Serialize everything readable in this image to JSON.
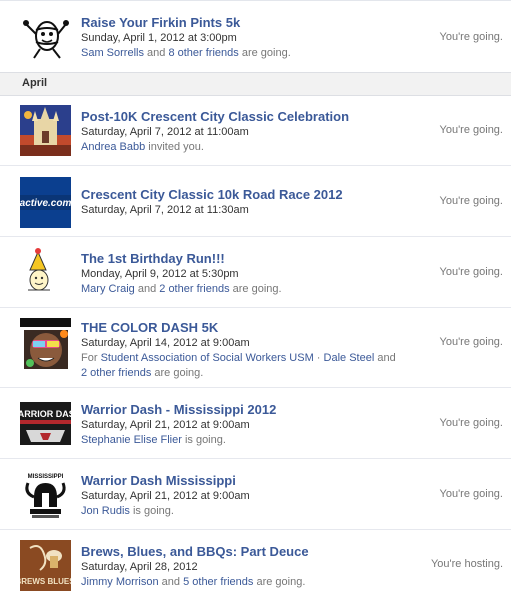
{
  "month_header": "April",
  "events": [
    {
      "title": "Raise Your Firkin Pints 5k",
      "date": "Sunday, April 1, 2012",
      "at": "at",
      "time": "3:00pm",
      "social": [
        {
          "t": "Sam Sorrells",
          "link": true
        },
        {
          "t": " and ",
          "link": false
        },
        {
          "t": "8 other friends",
          "link": true
        },
        {
          "t": " are going.",
          "link": false
        }
      ],
      "status": "You're going.",
      "icon": "keg-mascot-icon"
    },
    {
      "title": "Post-10K Crescent City Classic Celebration",
      "date": "Saturday, April 7, 2012",
      "at": "at",
      "time": "11:00am",
      "social": [
        {
          "t": "Andrea Babb",
          "link": true
        },
        {
          "t": " invited you.",
          "link": false
        }
      ],
      "status": "You're going.",
      "icon": "cathedral-painting-icon"
    },
    {
      "title": "Crescent City Classic 10k Road Race 2012",
      "date": "Saturday, April 7, 2012",
      "at": "at",
      "time": "11:30am",
      "social": [],
      "status": "You're going.",
      "icon": "active-com-logo-icon",
      "logo_text": "active.com"
    },
    {
      "title": "The 1st Birthday Run!!!",
      "date": "Monday, April 9, 2012",
      "at": "at",
      "time": "5:30pm",
      "social": [
        {
          "t": "Mary Craig",
          "link": true
        },
        {
          "t": " and ",
          "link": false
        },
        {
          "t": "2 other friends",
          "link": true
        },
        {
          "t": " are going.",
          "link": false
        }
      ],
      "status": "You're going.",
      "icon": "party-hat-icon"
    },
    {
      "title": "THE COLOR DASH 5K",
      "date": "Saturday, April 14, 2012",
      "at": "at",
      "time": "9:00am",
      "social": [
        {
          "t": "For ",
          "link": false
        },
        {
          "t": "Student Association of Social Workers USM",
          "link": true
        },
        {
          "t": " · ",
          "link": false
        },
        {
          "t": "Dale Steel",
          "link": true
        },
        {
          "t": " and",
          "link": false
        }
      ],
      "social2": [
        {
          "t": "2 other friends",
          "link": true
        },
        {
          "t": " are going.",
          "link": false
        }
      ],
      "status": "You're going.",
      "icon": "color-dash-runner-icon"
    },
    {
      "title": "Warrior Dash - Mississippi 2012",
      "date": "Saturday, April 21, 2012",
      "at": "at",
      "time": "9:00am",
      "social": [
        {
          "t": "Stephanie Elise Flier",
          "link": true
        },
        {
          "t": " is going.",
          "link": false
        }
      ],
      "status": "You're going.",
      "icon": "warrior-dash-logo-icon",
      "logo_text": "WARRIOR DASH"
    },
    {
      "title": "Warrior Dash Mississippi",
      "date": "Saturday, April 21, 2012",
      "at": "at",
      "time": "9:00am",
      "social": [
        {
          "t": "Jon Rudis",
          "link": true
        },
        {
          "t": " is going.",
          "link": false
        }
      ],
      "status": "You're going.",
      "icon": "warrior-helmet-logo-icon",
      "logo_text": "MISSISSIPPI"
    },
    {
      "title": "Brews, Blues, and BBQs: Part Deuce",
      "date": "Saturday, April 28, 2012",
      "at": "",
      "time": "",
      "social": [
        {
          "t": "Jimmy Morrison",
          "link": true
        },
        {
          "t": " and ",
          "link": false
        },
        {
          "t": "5 other friends",
          "link": true
        },
        {
          "t": " are going.",
          "link": false
        }
      ],
      "status": "You're hosting.",
      "icon": "brews-blues-poster-icon",
      "logo_text": "BREWS BLUES"
    }
  ]
}
